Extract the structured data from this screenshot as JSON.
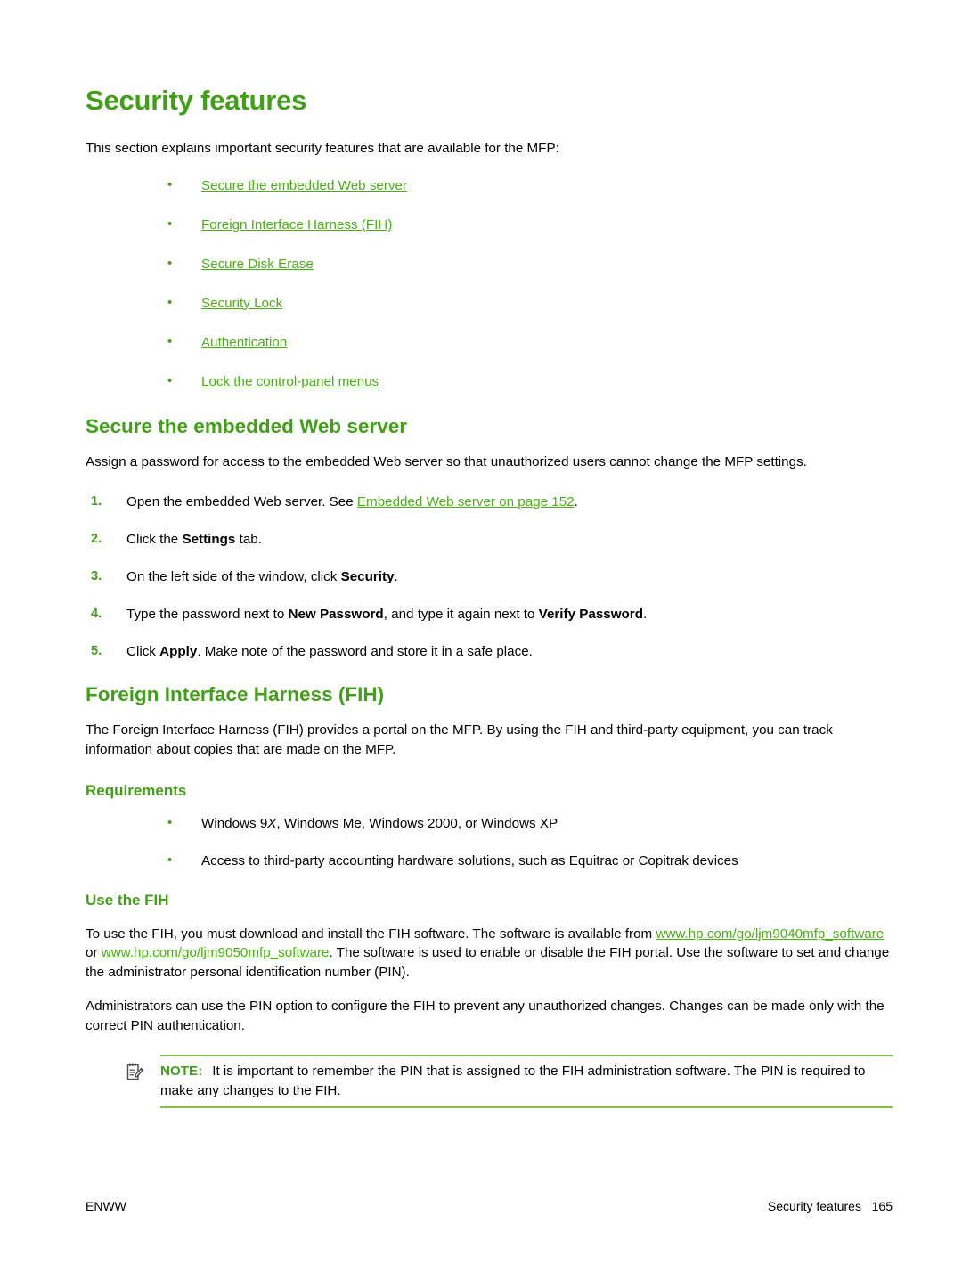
{
  "page": {
    "title": "Security features",
    "intro": "This section explains important security features that are available for the MFP:",
    "accent_color": "#41a017",
    "link_color": "#4ab013",
    "note_rule_color": "#7dc242"
  },
  "toc_links": [
    {
      "label": "Secure the embedded Web server"
    },
    {
      "label": "Foreign Interface Harness (FIH)"
    },
    {
      "label": "Secure Disk Erase"
    },
    {
      "label": "Security Lock"
    },
    {
      "label": "Authentication"
    },
    {
      "label": "Lock the control-panel menus"
    }
  ],
  "section_ews": {
    "heading": "Secure the embedded Web server",
    "intro": "Assign a password for access to the embedded Web server so that unauthorized users cannot change the MFP settings.",
    "steps": [
      {
        "pre": "Open the embedded Web server. See ",
        "link": "Embedded Web server on page 152",
        "post": "."
      },
      {
        "pre": "Click the ",
        "bold": "Settings",
        "post": " tab."
      },
      {
        "pre": "On the left side of the window, click ",
        "bold": "Security",
        "post": "."
      },
      {
        "pre": "Type the password next to ",
        "bold": "New Password",
        "mid": ", and type it again next to ",
        "bold2": "Verify Password",
        "post": "."
      },
      {
        "pre": "Click ",
        "bold": "Apply",
        "post": ". Make note of the password and store it in a safe place."
      }
    ]
  },
  "section_fih": {
    "heading": "Foreign Interface Harness (FIH)",
    "intro": "The Foreign Interface Harness (FIH) provides a portal on the MFP. By using the FIH and third-party equipment, you can track information about copies that are made on the MFP.",
    "requirements": {
      "heading": "Requirements",
      "items": [
        {
          "pre": "Windows 9",
          "italic": "X",
          "post": ", Windows Me, Windows 2000, or Windows XP"
        },
        {
          "pre": "Access to third-party accounting hardware solutions, such as Equitrac or Copitrak devices"
        }
      ]
    },
    "use": {
      "heading": "Use the FIH",
      "para1_pre": "To use the FIH, you must download and install the FIH software. The software is available from ",
      "url1": "www.hp.com/go/ljm9040mfp_software",
      "para1_mid": " or ",
      "url2": "www.hp.com/go/ljm9050mfp_software",
      "para1_post": ". The software is used to enable or disable the FIH portal. Use the software to set and change the administrator personal identification number (PIN).",
      "para2": "Administrators can use the PIN option to configure the FIH to prevent any unauthorized changes. Changes can be made only with the correct PIN authentication."
    },
    "note": {
      "label": "NOTE:",
      "text": "It is important to remember the PIN that is assigned to the FIH administration software. The PIN is required to make any changes to the FIH."
    }
  },
  "footer": {
    "left": "ENWW",
    "right": "Security features   165"
  }
}
